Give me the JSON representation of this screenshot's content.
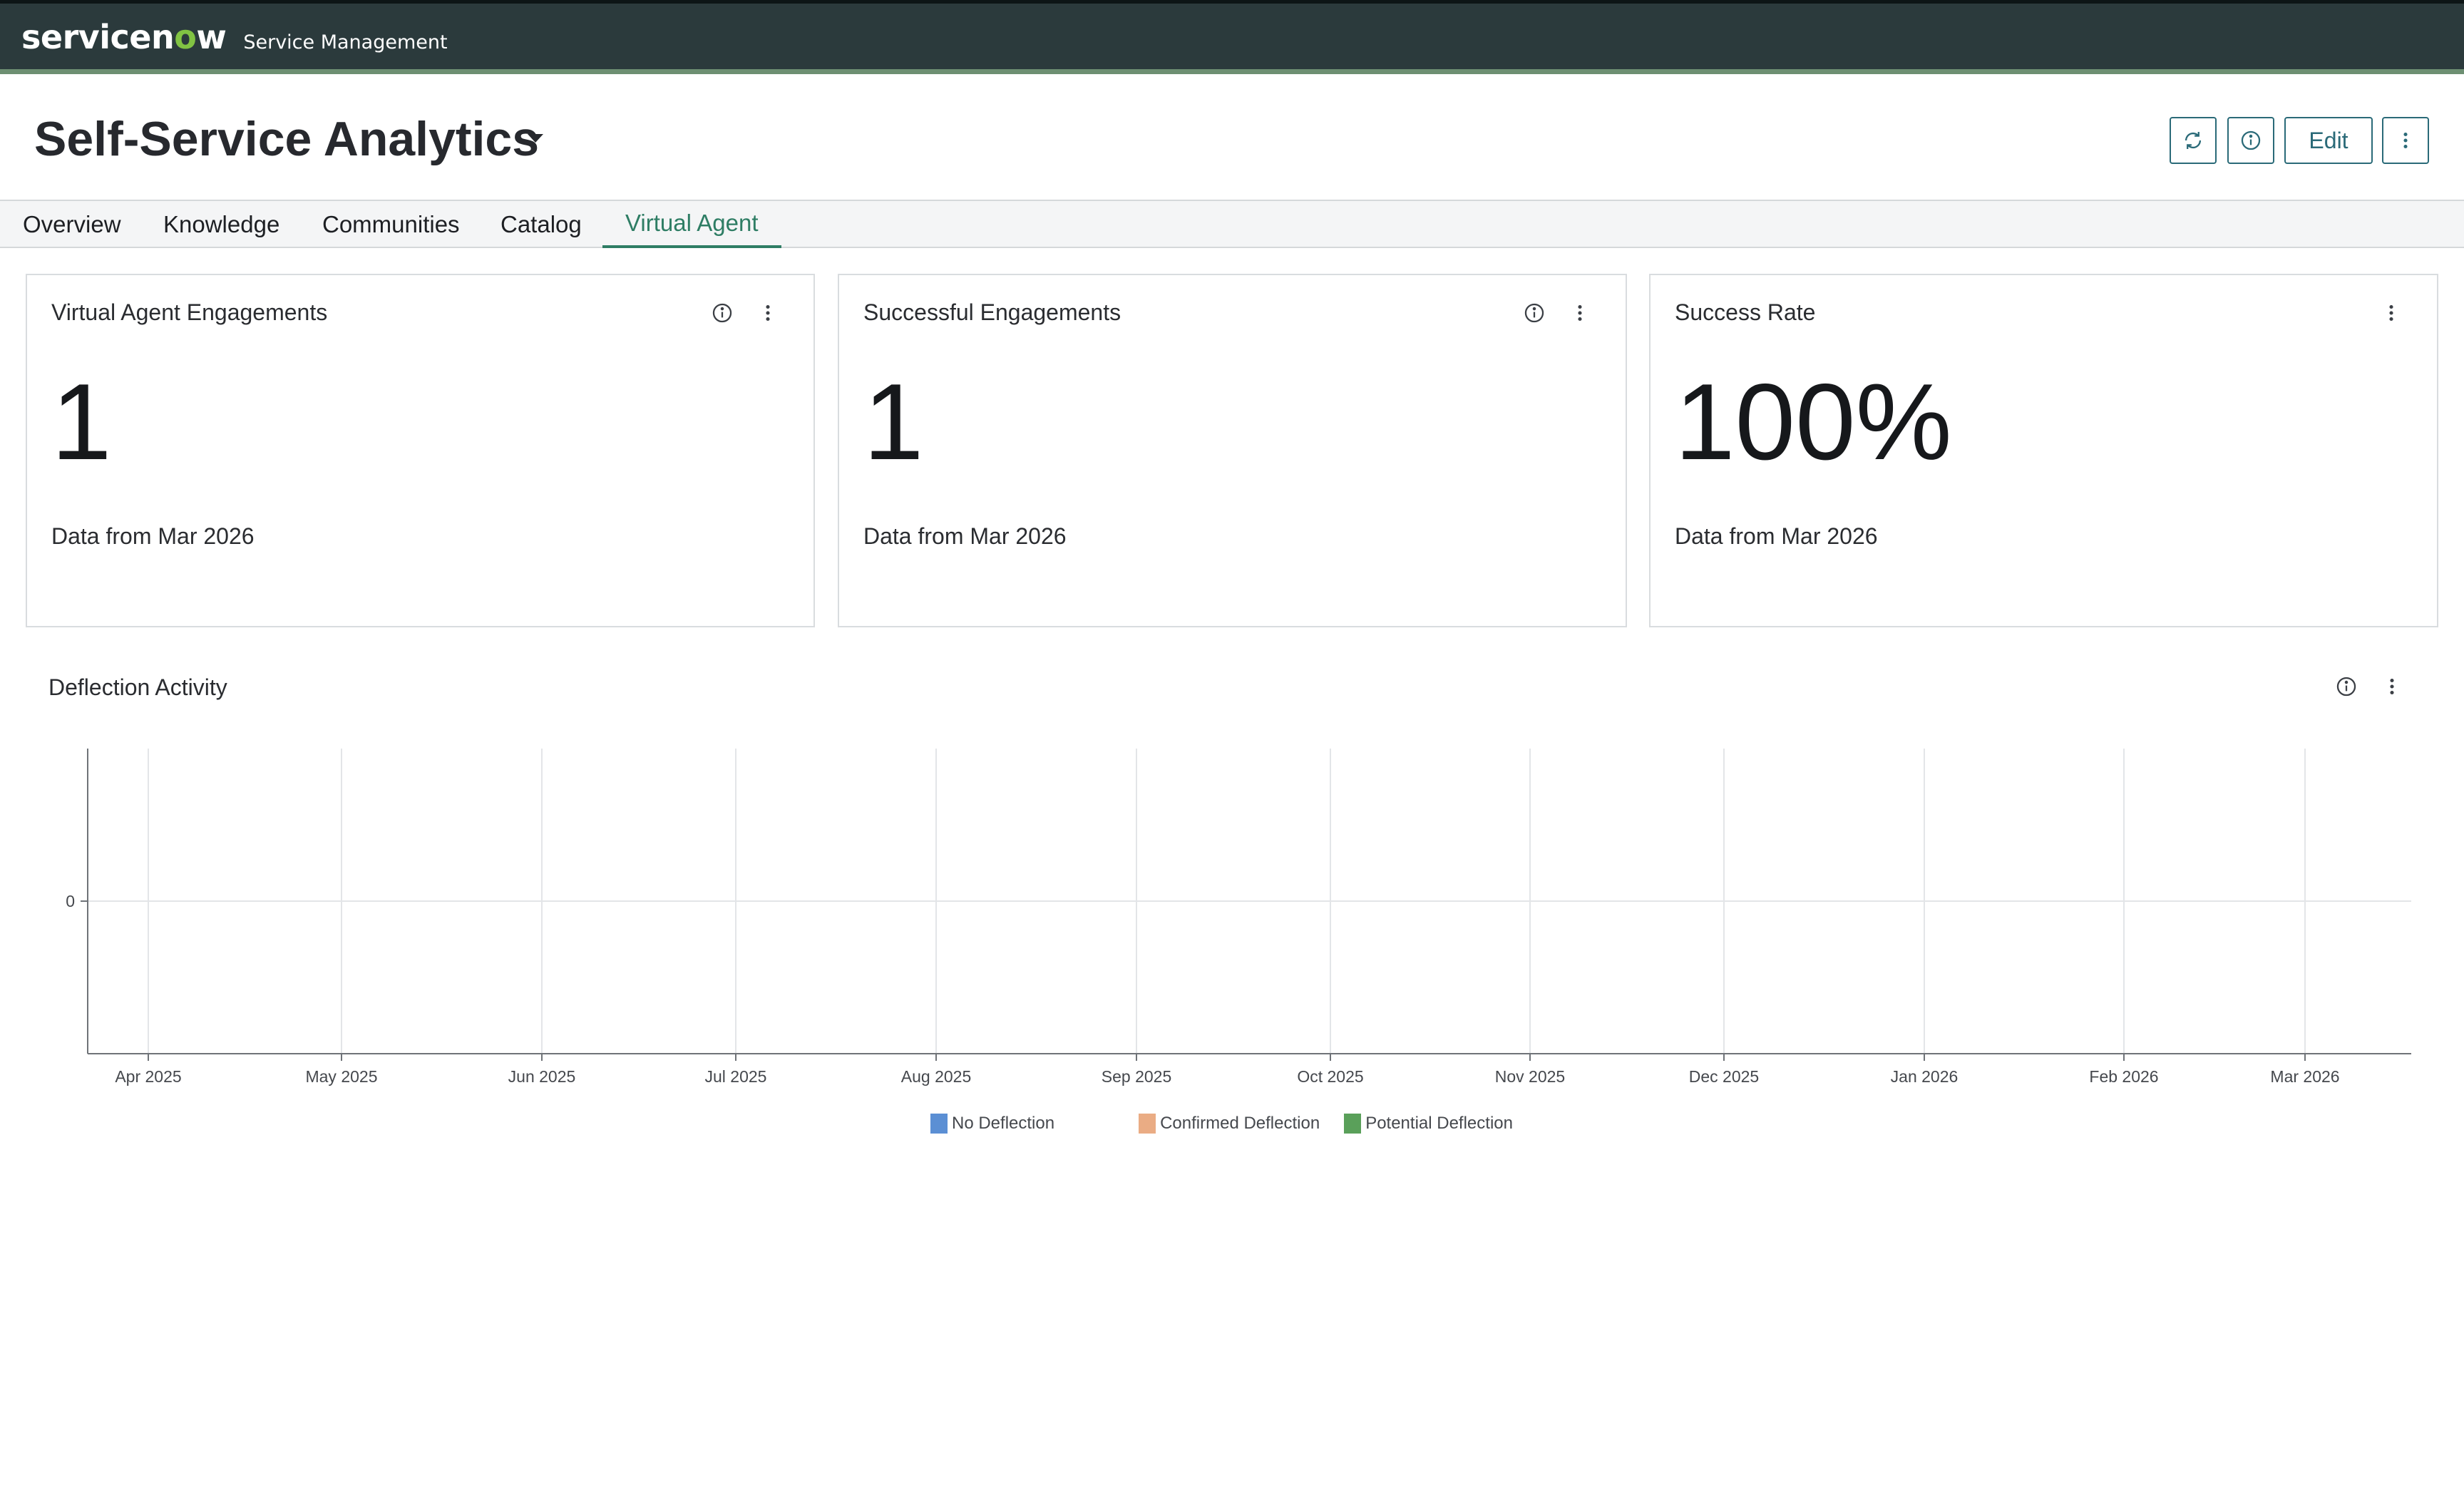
{
  "topbar": {
    "brand_prefix": "servicen",
    "brand_o": "o",
    "brand_suffix": "w",
    "product": "Service Management"
  },
  "page": {
    "title": "Self-Service Analytics",
    "buttons": {
      "refresh_icon": "refresh-icon",
      "info_icon": "info-icon",
      "edit_label": "Edit",
      "more_icon": "more-vertical-icon"
    }
  },
  "tabs": [
    {
      "label": "Overview",
      "active": false
    },
    {
      "label": "Knowledge",
      "active": false
    },
    {
      "label": "Communities",
      "active": false
    },
    {
      "label": "Catalog",
      "active": false
    },
    {
      "label": "Virtual Agent",
      "active": true
    }
  ],
  "cards": [
    {
      "title": "Virtual Agent Engagements",
      "value": "1",
      "sub": "Data from Mar 2026",
      "has_info": true
    },
    {
      "title": "Successful Engagements",
      "value": "1",
      "sub": "Data from Mar 2026",
      "has_info": true
    },
    {
      "title": "Success Rate",
      "value": "100%",
      "sub": "Data from Mar 2026",
      "has_info": false
    }
  ],
  "chart_section": {
    "title": "Deflection Activity"
  },
  "chart_data": {
    "type": "line",
    "title": "Deflection Activity",
    "categories": [
      "Apr 2025",
      "May 2025",
      "Jun 2025",
      "Jul 2025",
      "Aug 2025",
      "Sep 2025",
      "Oct 2025",
      "Nov 2025",
      "Dec 2025",
      "Jan 2026",
      "Feb 2026",
      "Mar 2026"
    ],
    "y_ticks": [
      "0"
    ],
    "series": [
      {
        "name": "No Deflection",
        "color": "#5b8fd4",
        "values": []
      },
      {
        "name": "Confirmed Deflection",
        "color": "#eaac84",
        "values": []
      },
      {
        "name": "Potential Deflection",
        "color": "#5aa05a",
        "values": []
      }
    ],
    "grid": true,
    "legend": "bottom"
  },
  "colors": {
    "accent": "#2e7d64",
    "topbar": "#2b3a3c",
    "brand_green": "#81c343"
  }
}
